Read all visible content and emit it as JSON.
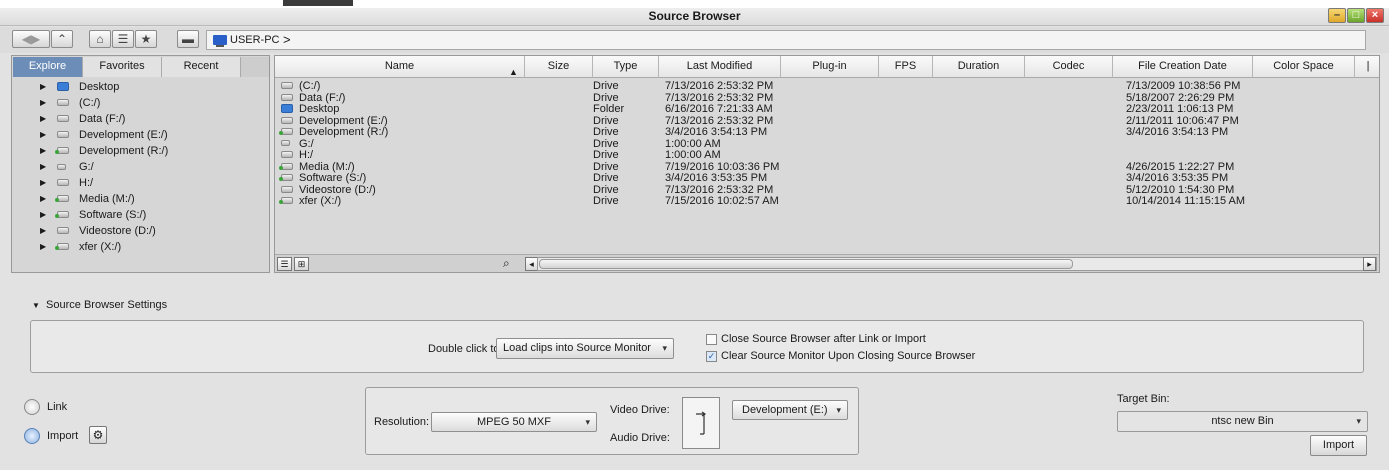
{
  "window": {
    "title": "Source Browser"
  },
  "toolbar": {
    "path_label": "USER-PC",
    "path_chevron": ">"
  },
  "left_tabs": [
    "Explore",
    "Favorites",
    "Recent"
  ],
  "tree": [
    {
      "label": "Desktop",
      "icon": "folder-icon"
    },
    {
      "label": "(C:/)",
      "icon": "drive-icon"
    },
    {
      "label": "Data (F:/)",
      "icon": "drive-icon"
    },
    {
      "label": "Development (E:/)",
      "icon": "drive-icon"
    },
    {
      "label": "Development (R:/)",
      "icon": "network-drive-icon"
    },
    {
      "label": "G:/",
      "icon": "card-reader-icon"
    },
    {
      "label": "H:/",
      "icon": "drive-icon"
    },
    {
      "label": "Media (M:/)",
      "icon": "network-drive-icon"
    },
    {
      "label": "Software (S:/)",
      "icon": "network-drive-icon"
    },
    {
      "label": "Videostore (D:/)",
      "icon": "drive-icon"
    },
    {
      "label": "xfer (X:/)",
      "icon": "network-drive-icon"
    }
  ],
  "columns": [
    "Name",
    "Size",
    "Type",
    "Last Modified",
    "Plug-in",
    "FPS",
    "Duration",
    "Codec",
    "File Creation Date",
    "Color Space"
  ],
  "rows": [
    {
      "name": "(C:/)",
      "type": "Drive",
      "modified": "7/13/2016 2:53:32 PM",
      "created": "7/13/2009 10:38:56 PM",
      "icon": "drive-icon"
    },
    {
      "name": "Data (F:/)",
      "type": "Drive",
      "modified": "7/13/2016 2:53:32 PM",
      "created": "5/18/2007 2:26:29 PM",
      "icon": "drive-icon"
    },
    {
      "name": "Desktop",
      "type": "Folder",
      "modified": "6/16/2016 7:21:33 AM",
      "created": "2/23/2011 1:06:13 PM",
      "icon": "folder-icon"
    },
    {
      "name": "Development (E:/)",
      "type": "Drive",
      "modified": "7/13/2016 2:53:32 PM",
      "created": "2/11/2011 10:06:47 PM",
      "icon": "drive-icon"
    },
    {
      "name": "Development (R:/)",
      "type": "Drive",
      "modified": "3/4/2016 3:54:13 PM",
      "created": "3/4/2016 3:54:13 PM",
      "icon": "network-drive-icon"
    },
    {
      "name": "G:/",
      "type": "Drive",
      "modified": "1:00:00 AM",
      "created": "",
      "icon": "card-reader-icon"
    },
    {
      "name": "H:/",
      "type": "Drive",
      "modified": "1:00:00 AM",
      "created": "",
      "icon": "drive-icon"
    },
    {
      "name": "Media (M:/)",
      "type": "Drive",
      "modified": "7/19/2016 10:03:36 PM",
      "created": "4/26/2015 1:22:27 PM",
      "icon": "network-drive-icon"
    },
    {
      "name": "Software (S:/)",
      "type": "Drive",
      "modified": "3/4/2016 3:53:35 PM",
      "created": "3/4/2016 3:53:35 PM",
      "icon": "network-drive-icon"
    },
    {
      "name": "Videostore (D:/)",
      "type": "Drive",
      "modified": "7/13/2016 2:53:32 PM",
      "created": "5/12/2010 1:54:30 PM",
      "icon": "drive-icon"
    },
    {
      "name": "xfer (X:/)",
      "type": "Drive",
      "modified": "7/15/2016 10:02:57 AM",
      "created": "10/14/2014 11:15:15 AM",
      "icon": "network-drive-icon"
    }
  ],
  "settings": {
    "header": "Source Browser Settings",
    "double_click_label": "Double click to:",
    "double_click_value": "Load clips into Source Monitor",
    "close_after_label": "Close Source Browser after Link or Import",
    "close_after_checked": false,
    "clear_monitor_label": "Clear Source Monitor Upon Closing Source Browser",
    "clear_monitor_checked": true
  },
  "mode": {
    "link_label": "Link",
    "import_label": "Import",
    "selected": "Import"
  },
  "import_options": {
    "resolution_label": "Resolution:",
    "resolution_value": "MPEG 50  MXF",
    "video_drive_label": "Video Drive:",
    "audio_drive_label": "Audio Drive:",
    "drive_value": "Development (E:)"
  },
  "target": {
    "label": "Target Bin:",
    "bin_value": "ntsc new Bin",
    "import_button": "Import"
  },
  "colors": {
    "accent": "#6b8db8",
    "folder": "#3b7ed8",
    "network_dot": "#3aa43a"
  }
}
